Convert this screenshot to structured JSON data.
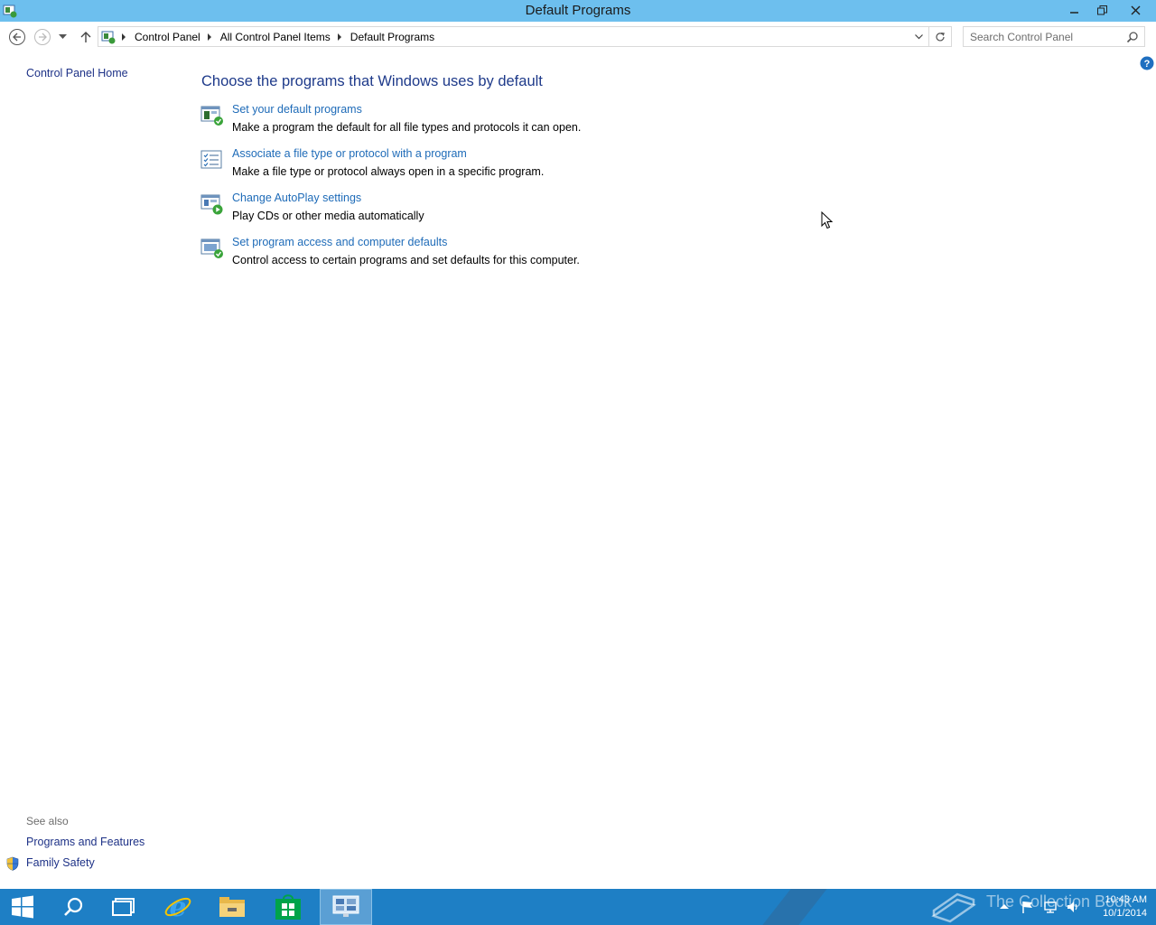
{
  "window": {
    "title": "Default Programs",
    "minimize_icon": "minimize-icon",
    "maximize_icon": "restore-icon",
    "close_icon": "close-icon"
  },
  "nav": {
    "back_icon": "back-arrow-icon",
    "forward_icon": "forward-arrow-icon",
    "recent_icon": "chevron-down-icon",
    "up_icon": "up-arrow-icon"
  },
  "address": {
    "crumbs": [
      "Control Panel",
      "All Control Panel Items",
      "Default Programs"
    ]
  },
  "search": {
    "placeholder": "Search Control Panel"
  },
  "left_pane": {
    "home_link": "Control Panel Home",
    "see_also_label": "See also",
    "see_also_links": [
      "Programs and Features",
      "Family Safety"
    ]
  },
  "main": {
    "heading": "Choose the programs that Windows uses by default",
    "tasks": [
      {
        "link": "Set your default programs",
        "desc": "Make a program the default for all file types and protocols it can open.",
        "icon": "default-programs-icon"
      },
      {
        "link": "Associate a file type or protocol with a program",
        "desc": "Make a file type or protocol always open in a specific program.",
        "icon": "file-association-icon"
      },
      {
        "link": "Change AutoPlay settings",
        "desc": "Play CDs or other media automatically",
        "icon": "autoplay-icon"
      },
      {
        "link": "Set program access and computer defaults",
        "desc": "Control access to certain programs and set defaults for this computer.",
        "icon": "program-access-icon"
      }
    ]
  },
  "taskbar": {
    "watermark": "The Collection Book",
    "time": "10:43 AM",
    "date": "10/1/2014",
    "accent": "#1e7fc5"
  }
}
